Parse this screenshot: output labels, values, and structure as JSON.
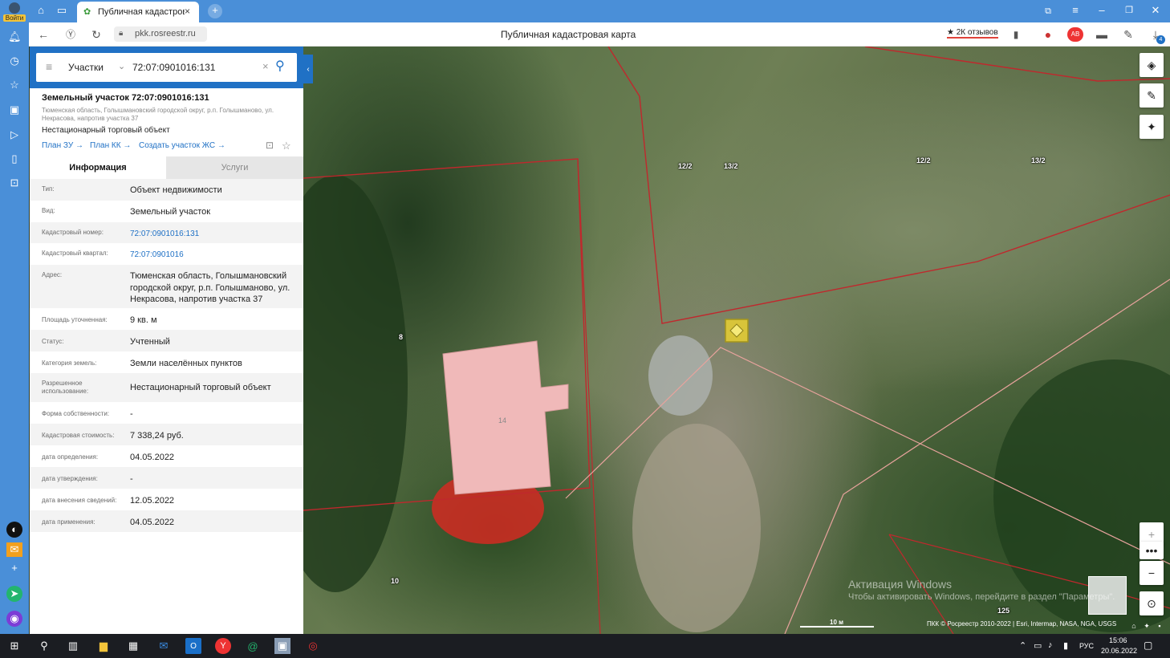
{
  "browser": {
    "tab_title": "Публичная кадастрова",
    "url": "pkk.rosreestr.ru",
    "page_title": "Публичная кадастровая карта",
    "reviews_label": "2К отзывов",
    "login_label": "Войти",
    "download_count": "4"
  },
  "search": {
    "type": "Участки",
    "query": "72:07:0901016:131"
  },
  "object": {
    "title": "Земельный участок 72:07:0901016:131",
    "address_short": "Тюменская область, Голышмановский городской округ, р.п. Голышманово, ул. Некрасова, напротив участка 37",
    "use": "Нестационарный торговый объект",
    "links": [
      "План ЗУ →",
      "План КК →",
      "Создать участок ЖС →"
    ]
  },
  "tabs": [
    "Информация",
    "Услуги"
  ],
  "details": [
    {
      "label": "Тип:",
      "value": "Объект недвижимости"
    },
    {
      "label": "Вид:",
      "value": "Земельный участок"
    },
    {
      "label": "Кадастровый номер:",
      "value": "72:07:0901016:131"
    },
    {
      "label": "Кадастровый квартал:",
      "value": "72:07:0901016"
    },
    {
      "label": "Адрес:",
      "value": "Тюменская область, Голышмановский городской округ, р.п. Голышманово, ул. Некрасова, напротив участка 37"
    },
    {
      "label": "Площадь уточненная:",
      "value": "9 кв. м"
    },
    {
      "label": "Статус:",
      "value": "Учтенный"
    },
    {
      "label": "Категория земель:",
      "value": "Земли населённых пунктов"
    },
    {
      "label": "Разрешенное использование:",
      "value": "Нестационарный торговый объект"
    },
    {
      "label": "Форма собственности:",
      "value": "-"
    },
    {
      "label": "Кадастровая стоимость:",
      "value": "7 338,24 руб."
    },
    {
      "label": "дата определения:",
      "value": "04.05.2022"
    },
    {
      "label": "дата утверждения:",
      "value": "-"
    },
    {
      "label": "дата внесения сведений:",
      "value": "12.05.2022"
    },
    {
      "label": "дата применения:",
      "value": "04.05.2022"
    }
  ],
  "map": {
    "labels": [
      "12/2",
      "13/2",
      "12/2",
      "13/2",
      "8",
      "14",
      "10",
      "125"
    ],
    "scale": "10 м",
    "attribution": "ПКК © Росреестр 2010-2022 | Esri, Intermap, NASA, NGA, USGS",
    "win_activation_title": "Активация Windows",
    "win_activation_text": "Чтобы активировать Windows, перейдите в раздел \"Параметры\"."
  },
  "taskbar": {
    "lang": "РУС",
    "time": "15:06",
    "date": "20.06.2022"
  },
  "colors": {
    "browser_blue": "#4a8fd8",
    "search_blue": "#2071c5",
    "parcel_border": "#c0282d",
    "parcel_fill_pink": "#f0b9b9",
    "highlight_yellow": "#e8d23a"
  }
}
